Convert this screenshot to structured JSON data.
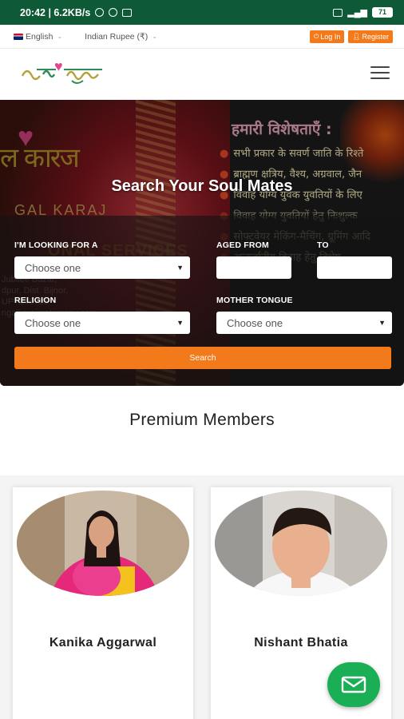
{
  "status_bar": {
    "time_speed": "20:42 | 6.2KB/s",
    "battery": "71"
  },
  "topbar": {
    "language": "English",
    "currency": "Indian Rupee (₹)",
    "login_label": "Log In",
    "register_label": "Register"
  },
  "hero": {
    "title": "Search Your Soul Mates",
    "background_text": {
      "hindi_title": "हमारी विशेषताएँ :",
      "hindi_lines": [
        "सभी प्रकार के सवर्ण जाति के रिश्ते",
        "ब्राह्मण क्षत्रिय, वैश्य, अग्रवाल, जैन",
        "विवाह योग्य युवक युवतियों के लिए",
        "विवाह योग्य युवतियों हेतु निःशुल्क",
        "सोफ्टवेयर मेकिंग-मैचिंग, ग्रूमिंग आदि",
        "अन्तर्जातीय विवाह हेतु विशेष"
      ],
      "logo_partial": "ल कारज",
      "logo_sub": "GAL KARAJ",
      "services": "ONAL SERVICES",
      "address_lines": [
        "Jubilee Bazar,",
        "dpur, Dist. Bijnor,",
        "UP- 246725",
        "ngalkarajmatrimony.com"
      ]
    }
  },
  "search_form": {
    "looking_for_label": "I'M LOOKING FOR A",
    "looking_for_value": "Choose one",
    "aged_from_label": "AGED FROM",
    "to_label": "TO",
    "religion_label": "RELIGION",
    "religion_value": "Choose one",
    "mother_tongue_label": "MOTHER TONGUE",
    "mother_tongue_value": "Choose one",
    "search_button": "Search"
  },
  "premium": {
    "title": "Premium Members",
    "members": [
      {
        "name": "Kanika Aggarwal"
      },
      {
        "name": "Nishant Bhatia"
      }
    ]
  },
  "colors": {
    "status_bar": "#0f5a36",
    "accent": "#f27a1a",
    "fab": "#1aae55"
  },
  "icons": {
    "login": "power-icon",
    "register": "user-icon",
    "menu": "hamburger-icon",
    "fab": "mail-icon"
  }
}
